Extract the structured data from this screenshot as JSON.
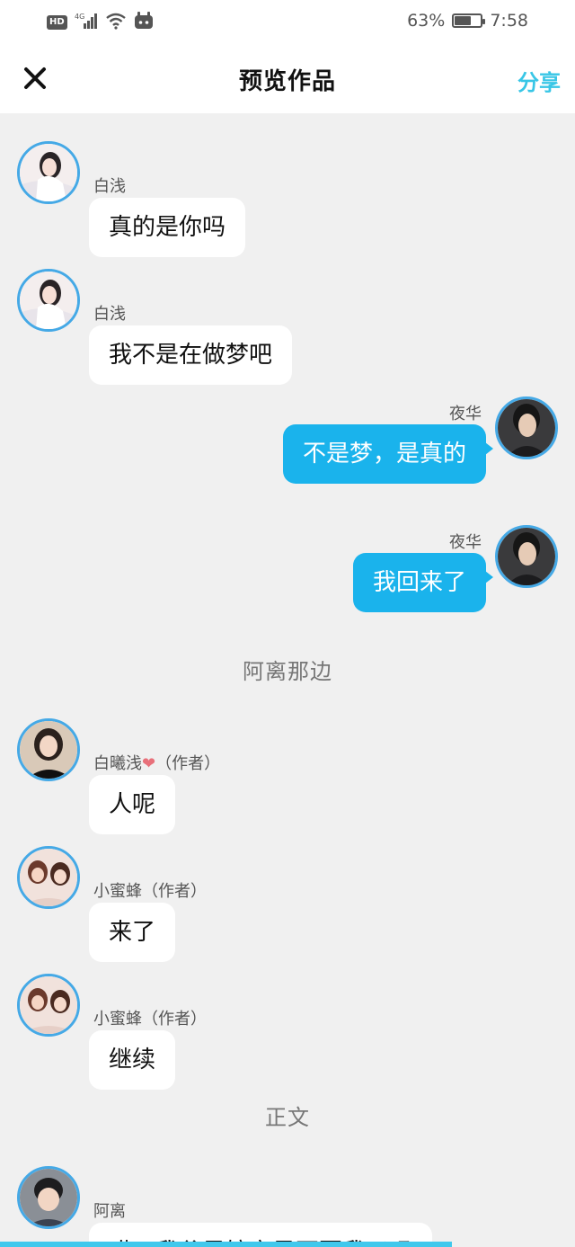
{
  "status_bar": {
    "hd_badge": "HD",
    "network": "4G",
    "battery_percent": "63%",
    "battery_level": 0.63,
    "time": "7:58"
  },
  "navbar": {
    "close_icon": "close-icon",
    "title": "预览作品",
    "share_label": "分享"
  },
  "messages": [
    {
      "side": "left",
      "sender": "白浅",
      "text": "真的是你吗",
      "avatar": "avatar-baiqian"
    },
    {
      "side": "left",
      "sender": "白浅",
      "text": "我不是在做梦吧",
      "avatar": "avatar-baiqian"
    },
    {
      "side": "right",
      "sender": "夜华",
      "text": "不是梦，是真的",
      "avatar": "avatar-yehua"
    },
    {
      "side": "right",
      "sender": "夜华",
      "text": "我回来了",
      "avatar": "avatar-yehua"
    },
    {
      "side": "left",
      "sender_name": "白曦浅",
      "sender_suffix": "（作者）",
      "sender_heart": "❤",
      "text": "人呢",
      "avatar": "avatar-baixiqian"
    },
    {
      "side": "left",
      "sender": "小蜜蜂（作者）",
      "text": "来了",
      "avatar": "avatar-xiaomifeng"
    },
    {
      "side": "left",
      "sender": "小蜜蜂（作者）",
      "text": "继续",
      "avatar": "avatar-xiaomifeng"
    },
    {
      "side": "left",
      "sender": "阿离",
      "text": "哎，我父君娘亲是不要我了吗",
      "avatar": "avatar-ali"
    }
  ],
  "sections": {
    "section_1": "阿离那边",
    "section_2": "正文"
  },
  "colors": {
    "accent": "#38c6e6",
    "bubble_blue": "#1ab3ec",
    "avatar_ring": "#45a9e6",
    "background": "#f0f0f0"
  }
}
